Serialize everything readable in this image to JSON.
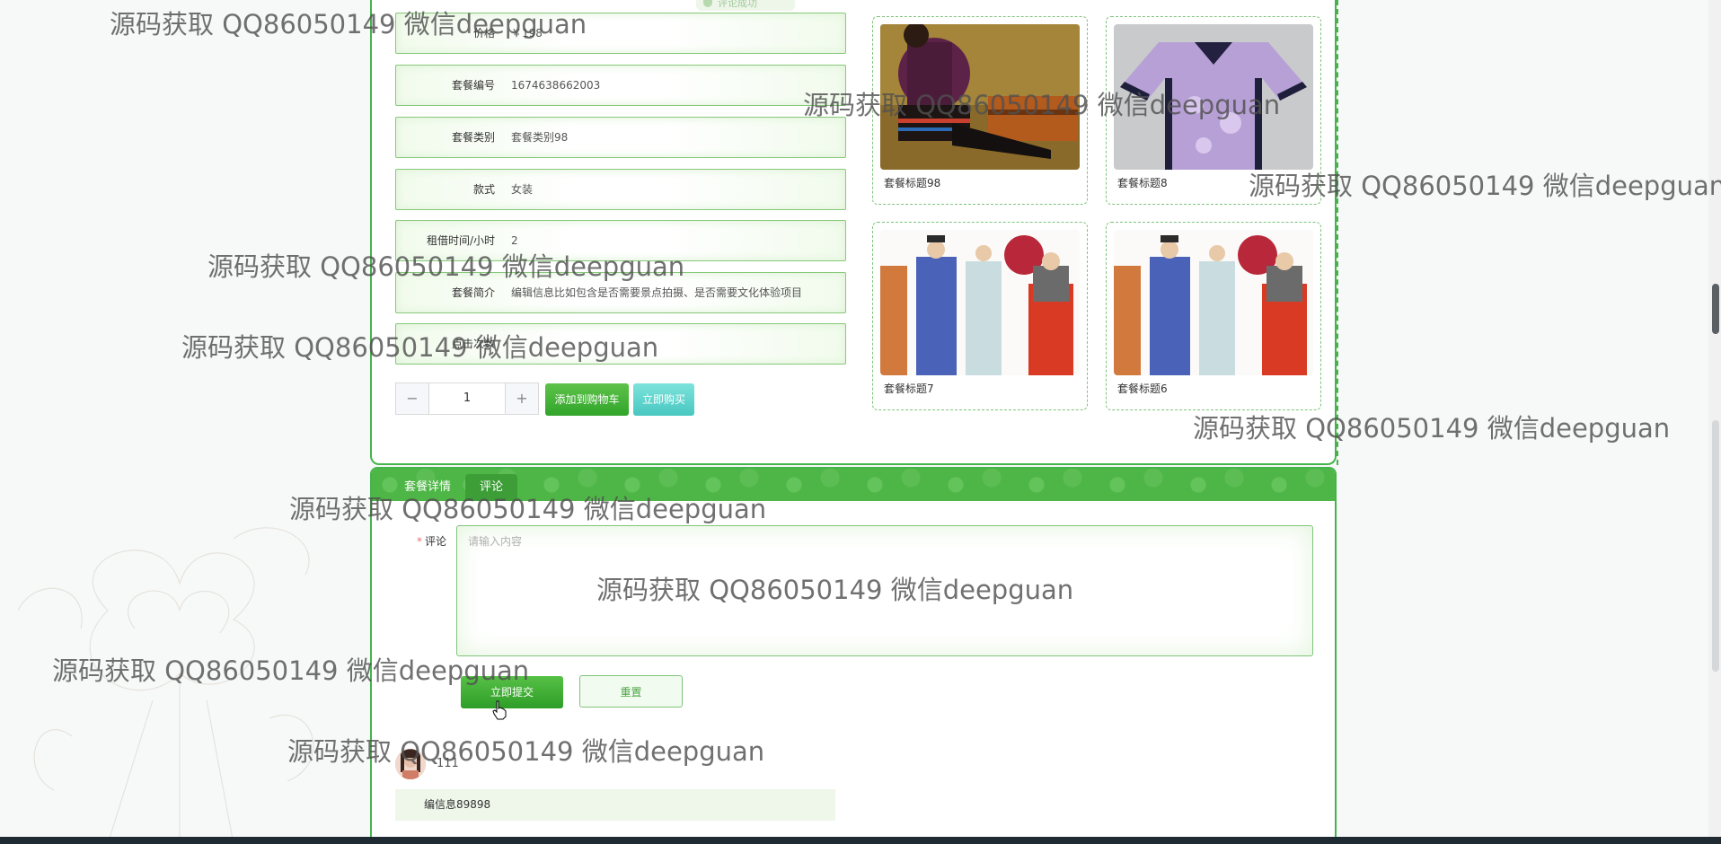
{
  "status_badge": "评论成功",
  "product": {
    "fields": [
      {
        "label": "价格",
        "value": "￥198"
      },
      {
        "label": "套餐编号",
        "value": "1674638662003"
      },
      {
        "label": "套餐类别",
        "value": "套餐类别98"
      },
      {
        "label": "款式",
        "value": "女装"
      },
      {
        "label": "租借时间/小时",
        "value": "2"
      },
      {
        "label": "套餐简介",
        "value": "编辑信息比如包含是否需要景点拍摄、是否需要文化体验项目"
      },
      {
        "label": "点击次数",
        "value": ""
      }
    ],
    "quantity": "1",
    "minus": "−",
    "plus": "+",
    "add_to_cart": "添加到购物车",
    "buy_now": "立即购买"
  },
  "recommendations": [
    {
      "title": "套餐标题98",
      "image": "woman-in-ethnic-dress-photo"
    },
    {
      "title": "套餐标题8",
      "image": "purple-qing-robe-photo"
    },
    {
      "title": "套餐标题7",
      "image": "historical-costume-illustration"
    },
    {
      "title": "套餐标题6",
      "image": "historical-costume-illustration"
    }
  ],
  "tabs": [
    {
      "label": "套餐详情",
      "active": false
    },
    {
      "label": "评论",
      "active": true
    }
  ],
  "comment_form": {
    "label": "评论",
    "placeholder": "请输入内容",
    "submit": "立即提交",
    "reset": "重置"
  },
  "comments": [
    {
      "user": "111",
      "content": "编信息89898"
    }
  ],
  "watermark": "源码获取 QQ86050149 微信deepguan",
  "colors": {
    "primary": "#44b44a",
    "accent_cyan": "#48c7c0",
    "required": "#f56c6c"
  }
}
